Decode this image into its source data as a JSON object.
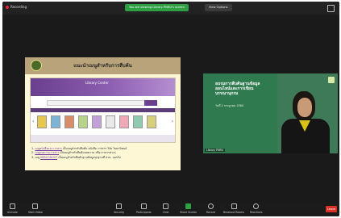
{
  "topbar": {
    "recording": "Recording",
    "sharing": "You are viewing Library PNRU's screen",
    "view_options": "View Options"
  },
  "slide": {
    "title": "แนะนำเมนูสำหรับการสืบค้น",
    "web_banner": "Library Center",
    "items": [
      "1. เมนูหนังสือและวารสาร เป็นเมนูสำหรับสืบค้น หนังสือ วารสาร วิจัย วิทยานิพนธ์",
      "2. เมนูบทความวารสาร เป็นเมนูสำหรับสืบค้นบทความ หรือวารสารต่างๆ",
      "3. เมนู EBSCOHOST เป็นเมนูสำหรับสืบค้นฐานข้อมูลทุกฐานที่ สวน. บอกรับ"
    ],
    "links": [
      "เมนูหนังสือและวารสาร",
      "เมนูบทความวารสาร",
      "EBSCOHOST"
    ]
  },
  "video": {
    "title": "อบรมการสืบค้นฐานข้อมูลออนไลน์และการเขียนบรรณานุกรม",
    "subtitle": "วันที่ 2 กรกฎาคม 2564",
    "name": "Library PNRU"
  },
  "toolbar": {
    "items": [
      {
        "label": "Unmute",
        "icon": "mic-icon"
      },
      {
        "label": "Start Video",
        "icon": "video-icon"
      },
      {
        "label": "Security",
        "icon": "shield-icon"
      },
      {
        "label": "Participants",
        "icon": "participants-icon"
      },
      {
        "label": "Chat",
        "icon": "chat-icon"
      },
      {
        "label": "Share Screen",
        "icon": "share-icon"
      },
      {
        "label": "Record",
        "icon": "record-icon"
      },
      {
        "label": "Breakout Rooms",
        "icon": "rooms-icon"
      },
      {
        "label": "Reactions",
        "icon": "smile-icon"
      }
    ],
    "leave": "Leave"
  },
  "colors": {
    "share_green": "#2ea043",
    "leave_red": "#d93025",
    "slide_bg": "#fdf7d6",
    "web_purple": "#6a3f8f"
  }
}
